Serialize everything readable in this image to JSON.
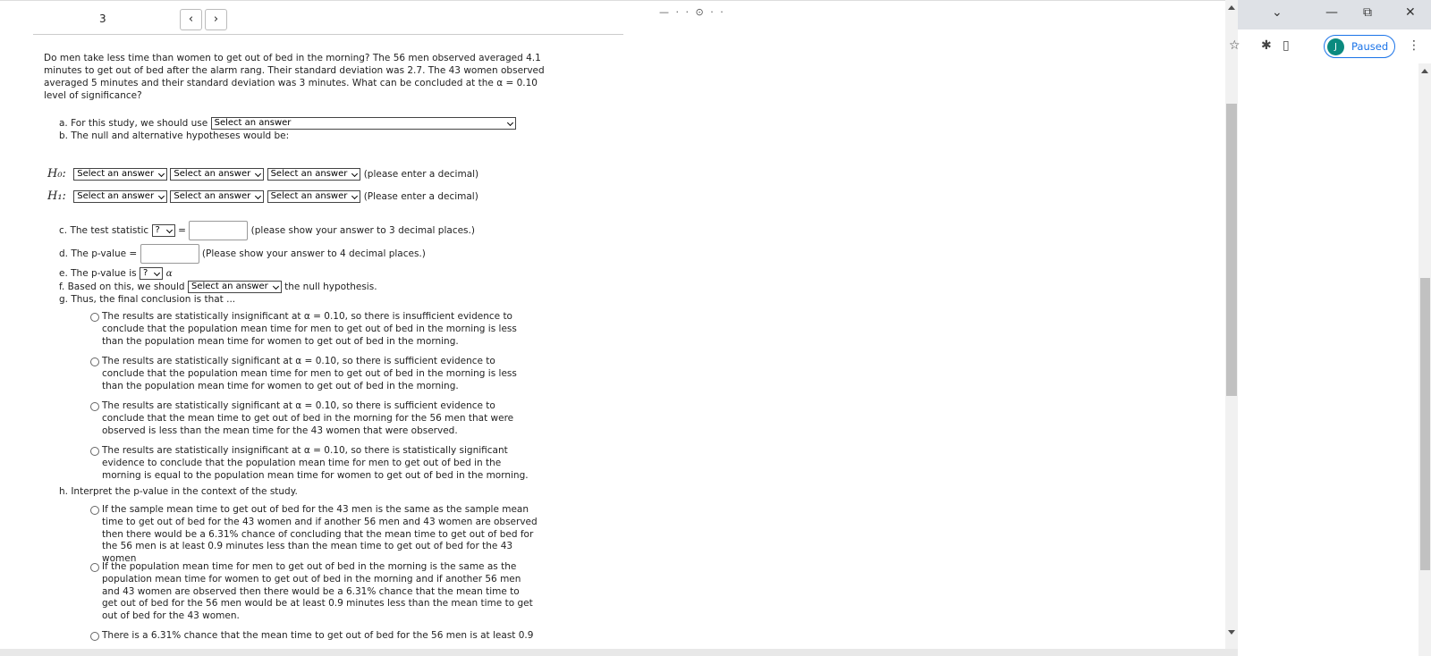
{
  "nav": {
    "question_number": "3",
    "prev": "‹",
    "next": "›"
  },
  "cutoff_text": "— · · ⊙ · ·",
  "chrome": {
    "chevron": "⌄",
    "minimize": "—",
    "restore": "⧉",
    "close": "✕",
    "star": "☆",
    "extensions": "✱",
    "sidepanel": "▯",
    "avatar_letter": "J",
    "paused": "Paused",
    "menu": "⋮"
  },
  "question": {
    "intro": "Do men take less time than women to get out of bed in the morning? The 56 men observed averaged 4.1 minutes to get out of bed after the alarm rang. Their standard deviation was 2.7. The 43 women observed averaged 5 minutes and their standard deviation was 3 minutes. What can be concluded at the α = 0.10 level of significance?",
    "a_label": "a. For this study, we should use",
    "a_select": "Select an answer",
    "b_label": "b. The null and alternative hypotheses would be:",
    "h0_label": "H₀:",
    "h1_label": "H₁:",
    "select_answer": "Select an answer",
    "h0_note": "(please enter a decimal)",
    "h1_note": "(Please enter a decimal)",
    "c_label": "c. The test statistic",
    "q_mark": "?",
    "equals": "=",
    "c_note": "(please show your answer to 3 decimal places.)",
    "d_label": "d. The p-value =",
    "d_note": "(Please show your answer to 4 decimal places.)",
    "e_label": "e. The p-value is",
    "alpha": "α",
    "f_label": "f. Based on this, we should",
    "f_select": "Select an answer",
    "f_after": "the null hypothesis.",
    "g_label": "g. Thus, the final conclusion is that ...",
    "g_options": [
      "The results are statistically insignificant at α = 0.10, so there is insufficient evidence to conclude that the population mean time for men to get out of bed in the morning is less than the population mean time for women to get out of bed in the morning.",
      "The results are statistically significant at α = 0.10, so there is sufficient evidence to conclude that the population mean time for men to get out of bed in the morning is less than the population mean time for women to get out of bed in the morning.",
      "The results are statistically significant at α = 0.10, so there is sufficient evidence to conclude that the mean time to get out of bed in the morning for the 56 men that were observed is less than the mean time for the 43 women that were observed.",
      "The results are statistically insignificant at α = 0.10, so there is statistically significant evidence to conclude that the population mean time for men to get out of bed in the morning is equal to the population mean time for women to get out of bed in the morning."
    ],
    "h_label": "h. Interpret the p-value in the context of the study.",
    "h_options": [
      "If the sample mean time to get out of bed for the 43 men is the same as the sample mean time to get out of bed for the 43 women and if another 56 men and 43 women are observed then there would be a 6.31% chance of concluding that the mean time to get out of bed for the 56 men is at least 0.9 minutes less than the mean time to get out of bed for the 43 women",
      "If the population mean time for men to get out of bed in the morning is the same as the population mean time for women to get out of bed in the morning and if another 56 men and 43 women are observed then there would be a 6.31% chance that the mean time to get out of bed for the 56 men would be at least 0.9 minutes less than the mean time to get out of bed for the 43 women.",
      "There is a 6.31% chance that the mean time to get out of bed for the 56 men is at least 0.9"
    ]
  }
}
